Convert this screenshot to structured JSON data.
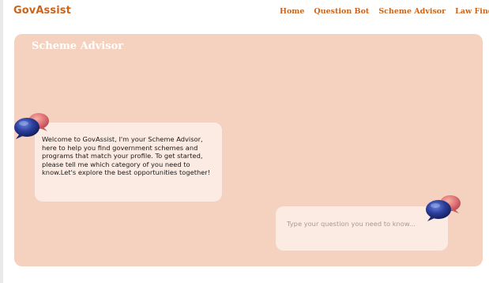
{
  "brand": "GovAssist",
  "nav": {
    "items": [
      {
        "label": "Home"
      },
      {
        "label": "Question Bot"
      },
      {
        "label": "Scheme Advisor"
      },
      {
        "label": "Law Finde"
      }
    ]
  },
  "panel": {
    "title": "Scheme Advisor",
    "bot_message": "Welcome to GovAssist, I'm your Scheme Advisor, here to help you find government schemes and programs that match your profile. To get started, please tell me which category of you need to know.Let's explore the best opportunities together!",
    "input": {
      "value": "",
      "placeholder": "Type your question you need to know..."
    }
  },
  "icons": {
    "bot_avatar": "chat-bubbles-icon",
    "user_avatar": "chat-bubbles-icon"
  },
  "colors": {
    "accent": "#c9651c",
    "panel_bg": "#f5d2c0",
    "bubble_bg": "#fbebe3",
    "icon_blue": "#2b3e9c",
    "icon_pink": "#e07474"
  }
}
